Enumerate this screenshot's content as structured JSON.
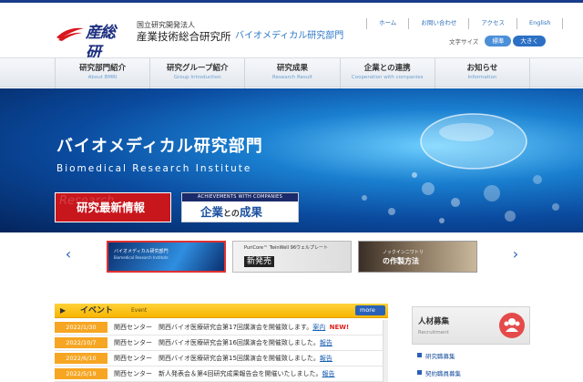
{
  "header": {
    "logo_text": "産総研",
    "org_sub": "国立研究開発法人",
    "org_name": "産業技術総合研究所",
    "dept_name": "バイオメディカル研究部門",
    "util_links": [
      "ホーム",
      "お問い合わせ",
      "アクセス",
      "English"
    ],
    "font_size_label": "文字サイズ",
    "font_size_options": [
      "標準",
      "大きく"
    ]
  },
  "nav": {
    "items": [
      {
        "jp": "研究部門紹介",
        "en": "About BMRI"
      },
      {
        "jp": "研究グループ紹介",
        "en": "Group Introduction"
      },
      {
        "jp": "研究成果",
        "en": "Research Result"
      },
      {
        "jp": "企業との連携",
        "en": "Cooperation with companies"
      },
      {
        "jp": "お知らせ",
        "en": "Information"
      }
    ]
  },
  "hero": {
    "title": "バイオメディカル研究部門",
    "subtitle": "Biomedical Research Institute",
    "latest_button": {
      "bg_text": "Research",
      "label": "研究最新情報"
    },
    "collab_button": {
      "top": "ACHIEVEMENTS WITH COMPANIES",
      "main": "企業",
      "connector": "との",
      "main2": "成果"
    }
  },
  "carousel": {
    "prev": "‹",
    "next": "›",
    "thumbs": [
      {
        "caption": "バイオメディカル研究部門",
        "sub": "Biomedical Research Institute"
      },
      {
        "caption": "PuriCore™ TwinWell 96ウェルプレート",
        "big": "新発売"
      },
      {
        "caption": "ノックインニワトリ",
        "big": "の作製方法"
      }
    ]
  },
  "events": {
    "title": "イベント",
    "title_en": "Event",
    "more": "more",
    "rows": [
      {
        "date": "2022/1/30",
        "text": "関西センター　関西バイオ医療研究会第17回講演会を開催致します。",
        "link": "案内",
        "new": "NEW!"
      },
      {
        "date": "2022/10/7",
        "text": "関西センター　関西バイオ医療研究会第16回講演会を開催致しました。",
        "link": "報告",
        "new": ""
      },
      {
        "date": "2022/6/10",
        "text": "関西センター　関西バイオ医療研究会第15回講演会を開催致しました。",
        "link": "報告",
        "new": ""
      },
      {
        "date": "2022/5/19",
        "text": "関西センター　新人発表会＆第4回研究成果報告会を開催いたしました。",
        "link": "報告",
        "new": ""
      }
    ]
  },
  "recruit": {
    "title": "人材募集",
    "title_en": "Recruitment",
    "links": [
      "研究職募集",
      "契約職員募集"
    ]
  },
  "colors": {
    "brand_blue": "#1c2f80",
    "accent_orange": "#f6a623",
    "accent_red": "#c8161d",
    "link_blue": "#2c6fb8"
  }
}
